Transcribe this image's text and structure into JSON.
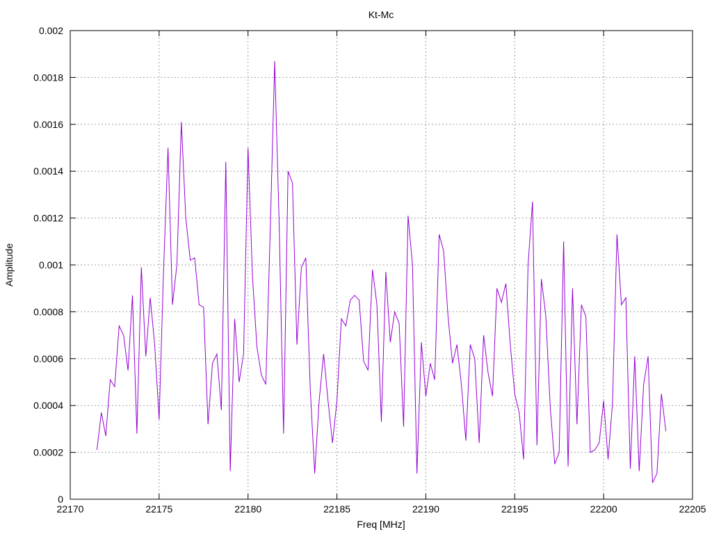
{
  "chart_data": {
    "type": "line",
    "title": "Kt-Mc",
    "xlabel": "Freq [MHz]",
    "ylabel": "Amplitude",
    "xlim": [
      22170,
      22205
    ],
    "ylim": [
      0,
      0.002
    ],
    "xticks": [
      "22170",
      "22175",
      "22180",
      "22185",
      "22190",
      "22195",
      "22200",
      "22205"
    ],
    "yticks": [
      "0",
      "0.0002",
      "0.0004",
      "0.0006",
      "0.0008",
      "0.001",
      "0.0012",
      "0.0014",
      "0.0016",
      "0.0018",
      "0.002"
    ],
    "grid": true,
    "line_color": "#9400d3",
    "series": [
      {
        "x": [
          22171.5,
          22171.75,
          22172.0,
          22172.25,
          22172.5,
          22172.75,
          22173.0,
          22173.25,
          22173.5,
          22173.75,
          22174.0,
          22174.25,
          22174.5,
          22174.75,
          22175.0,
          22175.25,
          22175.5,
          22175.75,
          22176.0,
          22176.25,
          22176.5,
          22176.75,
          22177.0,
          22177.25,
          22177.5,
          22177.75,
          22178.0,
          22178.25,
          22178.5,
          22178.75,
          22179.0,
          22179.25,
          22179.5,
          22179.75,
          22180.0,
          22180.25,
          22180.5,
          22180.75,
          22181.0,
          22181.25,
          22181.5,
          22181.75,
          22182.0,
          22182.25,
          22182.5,
          22182.75,
          22183.0,
          22183.25,
          22183.5,
          22183.75,
          22184.0,
          22184.25,
          22184.5,
          22184.75,
          22185.0,
          22185.25,
          22185.5,
          22185.75,
          22186.0,
          22186.25,
          22186.5,
          22186.75,
          22187.0,
          22187.25,
          22187.5,
          22187.75,
          22188.0,
          22188.25,
          22188.5,
          22188.75,
          22189.0,
          22189.25,
          22189.5,
          22189.75,
          22190.0,
          22190.25,
          22190.5,
          22190.75,
          22191.0,
          22191.25,
          22191.5,
          22191.75,
          22192.0,
          22192.25,
          22192.5,
          22192.75,
          22193.0,
          22193.25,
          22193.5,
          22193.75,
          22194.0,
          22194.25,
          22194.5,
          22194.75,
          22195.0,
          22195.25,
          22195.5,
          22195.75,
          22196.0,
          22196.25,
          22196.5,
          22196.75,
          22197.0,
          22197.25,
          22197.5,
          22197.75,
          22198.0,
          22198.25,
          22198.5,
          22198.75,
          22199.0,
          22199.25,
          22199.5,
          22199.75,
          22200.0,
          22200.25,
          22200.5,
          22200.75,
          22201.0,
          22201.25,
          22201.5,
          22201.75,
          22202.0,
          22202.25,
          22202.5,
          22202.75,
          22203.0,
          22203.25,
          22203.5
        ],
        "y": [
          0.00021,
          0.00037,
          0.00027,
          0.00051,
          0.00048,
          0.00074,
          0.0007,
          0.00055,
          0.00087,
          0.00028,
          0.00099,
          0.00061,
          0.00086,
          0.00066,
          0.00034,
          0.00098,
          0.0015,
          0.00083,
          0.001,
          0.00161,
          0.0012,
          0.00102,
          0.00103,
          0.00083,
          0.00082,
          0.00032,
          0.00058,
          0.00062,
          0.00038,
          0.00144,
          0.00012,
          0.00077,
          0.0005,
          0.00062,
          0.0015,
          0.00095,
          0.00065,
          0.00053,
          0.00049,
          0.00115,
          0.00187,
          0.00118,
          0.00028,
          0.0014,
          0.00135,
          0.00066,
          0.00099,
          0.00103,
          0.00047,
          0.00011,
          0.00042,
          0.00062,
          0.00042,
          0.00024,
          0.00042,
          0.00077,
          0.00074,
          0.00085,
          0.00087,
          0.00085,
          0.00059,
          0.00055,
          0.00098,
          0.00083,
          0.00033,
          0.00097,
          0.00067,
          0.0008,
          0.00075,
          0.00031,
          0.00121,
          0.001,
          0.00011,
          0.00067,
          0.00044,
          0.00058,
          0.00051,
          0.00113,
          0.00106,
          0.00078,
          0.00058,
          0.00066,
          0.00049,
          0.00025,
          0.00066,
          0.0006,
          0.00024,
          0.0007,
          0.00054,
          0.00044,
          0.0009,
          0.00084,
          0.00092,
          0.00066,
          0.00045,
          0.00037,
          0.00017,
          0.001,
          0.00127,
          0.00023,
          0.00094,
          0.00078,
          0.00039,
          0.00015,
          0.0002,
          0.0011,
          0.00014,
          0.0009,
          0.00032,
          0.00083,
          0.00078,
          0.0002,
          0.00021,
          0.00024,
          0.00042,
          0.00017,
          0.00041,
          0.00113,
          0.00083,
          0.00086,
          0.00013,
          0.00061,
          0.00012,
          0.00049,
          0.00061,
          7e-05,
          0.00011,
          0.00045,
          0.00029
        ]
      }
    ]
  }
}
